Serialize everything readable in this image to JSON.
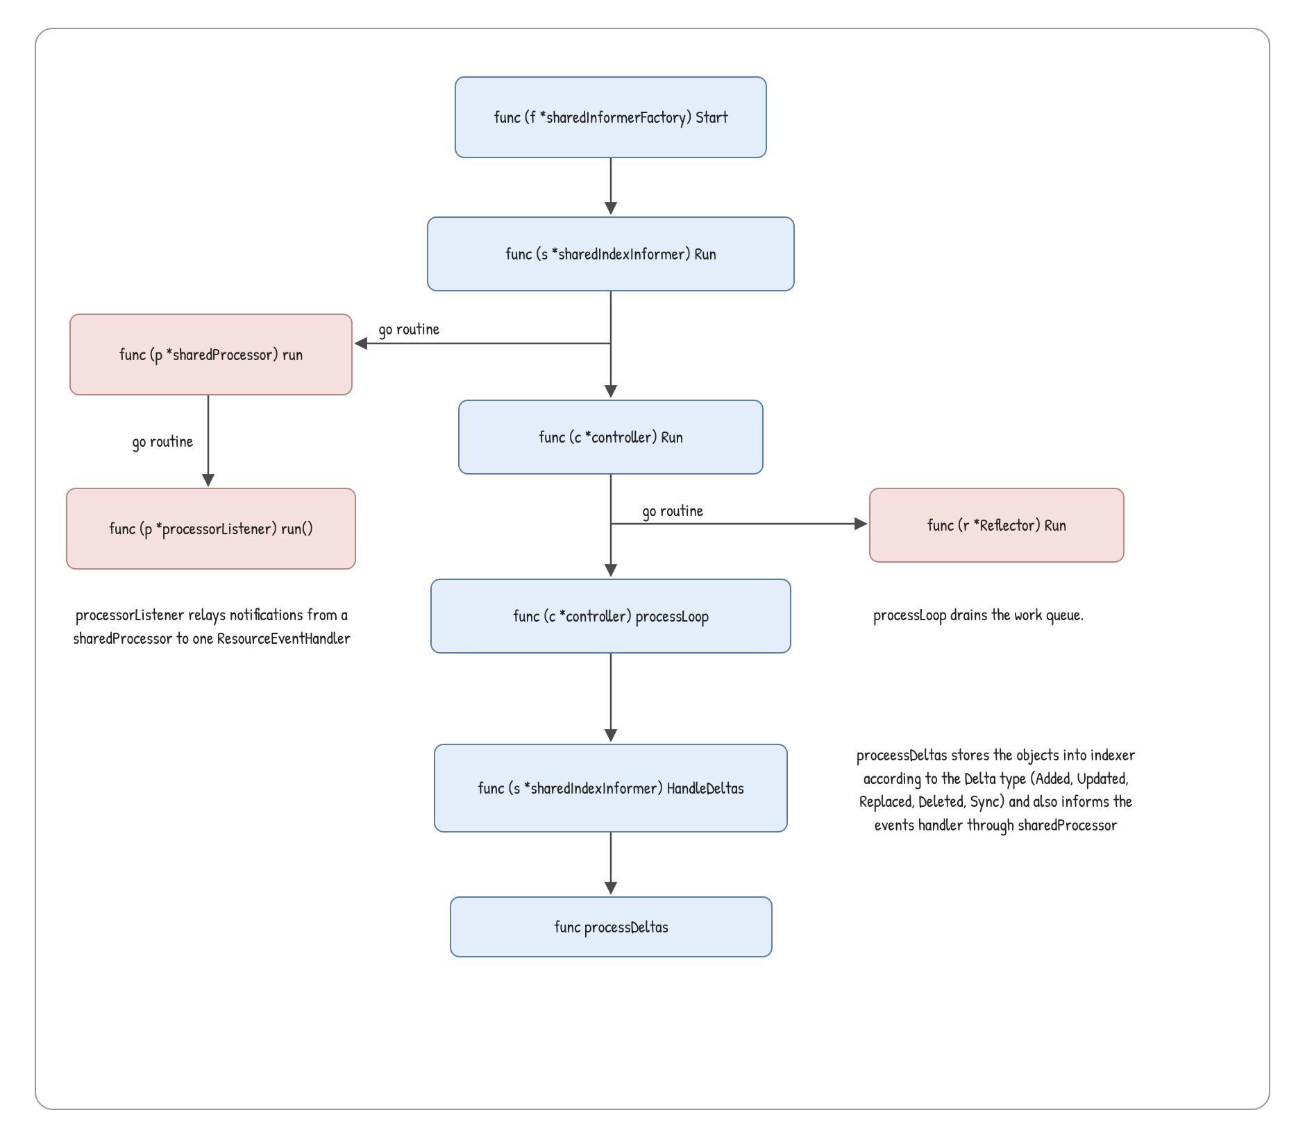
{
  "nodes": {
    "factoryStart": "func (f *sharedInformerFactory) Start",
    "sharedIndexInformerRun": "func (s *sharedIndexInformer) Run",
    "sharedProcessorRun": "func (p *sharedProcessor) run",
    "processorListenerRun": "func (p *processorListener) run()",
    "controllerRun": "func (c *controller) Run",
    "reflectorRun": "func (r *Reflector) Run",
    "processLoop": "func (c *controller) processLoop",
    "handleDeltas": "func (s *sharedIndexInformer) HandleDeltas",
    "processDeltas": "func processDeltas"
  },
  "edgeLabels": {
    "goRoutine1": "go routine",
    "goRoutine2": "go routine",
    "goRoutine3": "go routine"
  },
  "notes": {
    "listenerNote": "processorListener relays notifications from a sharedProcessor to one ResourceEventHandler",
    "processLoopNote": "processLoop drains the work queue.",
    "deltasNote": "proceessDeltas stores the objects into indexer according to the Delta type (Added, Updated, Replaced, Deleted, Sync) and also informs the events handler through sharedProcessor"
  },
  "colors": {
    "blueFill": "#e4eefa",
    "blueStroke": "#5d7fa6",
    "pinkFill": "#f4e0de",
    "pinkStroke": "#b88983",
    "frameStroke": "#999999",
    "arrowStroke": "#4b4b4b"
  }
}
